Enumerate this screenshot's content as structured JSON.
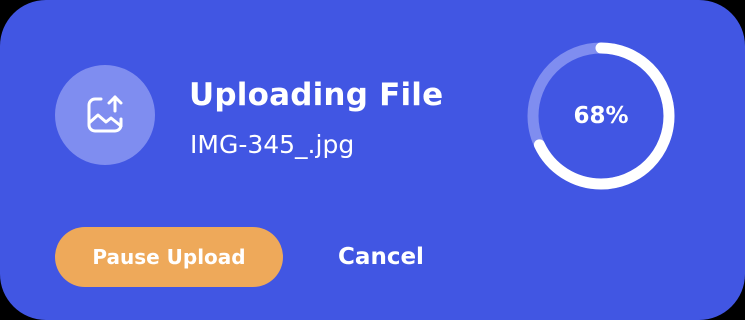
{
  "dialog": {
    "title": "Uploading File",
    "filename": "IMG-345_.jpg",
    "icon": "image-upload-icon"
  },
  "progress": {
    "percent": 68,
    "label": "68%"
  },
  "actions": {
    "pause_label": "Pause Upload",
    "cancel_label": "Cancel"
  },
  "colors": {
    "card_background": "#4156e3",
    "icon_circle": "#7f8df0",
    "progress_track": "#7f8df0",
    "progress_fill": "#ffffff",
    "pause_button": "#eea95a",
    "text": "#ffffff"
  }
}
